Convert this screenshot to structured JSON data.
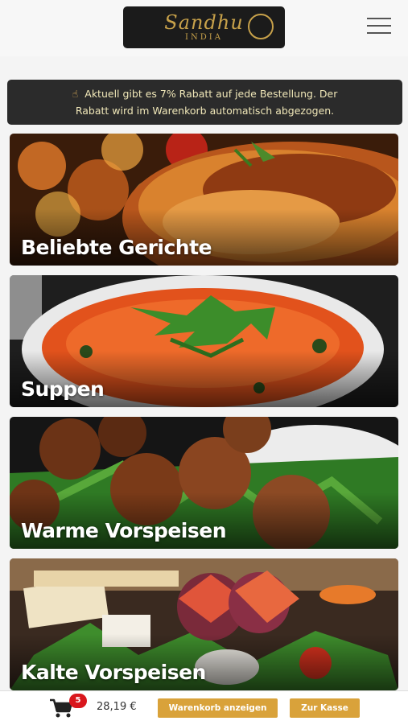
{
  "header": {
    "logo_brand": "Sandhu",
    "logo_sub": "INDIA"
  },
  "banner": {
    "text_line1": "Aktuell gibt es 7% Rabatt auf jede Bestellung. Der",
    "text_line2": "Rabatt wird im Warenkorb automatisch abgezogen."
  },
  "categories": [
    {
      "label": "Beliebte Gerichte"
    },
    {
      "label": "Suppen"
    },
    {
      "label": "Warme Vorspeisen"
    },
    {
      "label": "Kalte Vorspeisen"
    }
  ],
  "cart": {
    "count": "5",
    "total": "28,19 €",
    "view_button": "Warenkorb anzeigen",
    "checkout_button": "Zur Kasse"
  },
  "colors": {
    "accent": "#d9a23a",
    "badge": "#d9171d",
    "banner_bg": "#2b2b2b",
    "logo_gold": "#c7a14a"
  }
}
